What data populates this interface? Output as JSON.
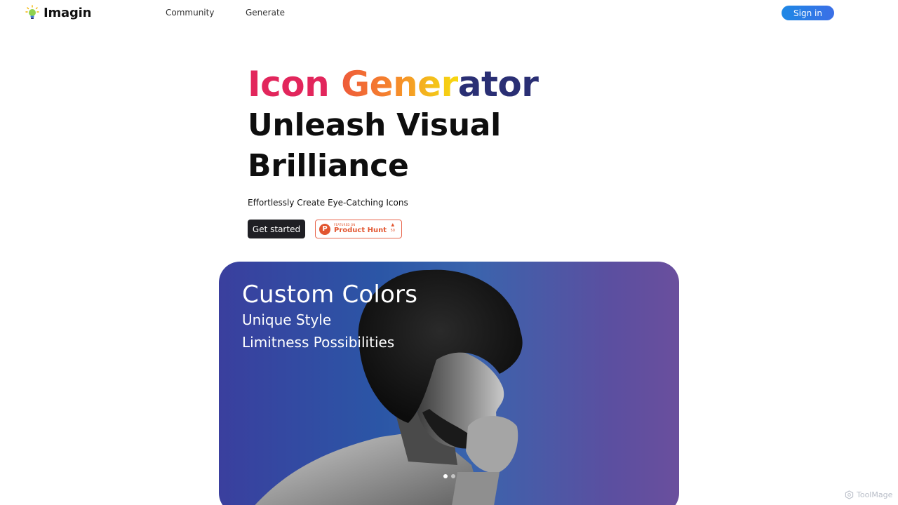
{
  "header": {
    "brand": "Imagin",
    "brand_icon": "lightbulb-icon",
    "nav": [
      "Community",
      "Generate"
    ],
    "signin_label": "Sign in"
  },
  "hero": {
    "title_parts": [
      "Icon",
      "Gener",
      "ator"
    ],
    "headline_line1": "Unleash Visual",
    "headline_line2": "Brilliance",
    "subtitle": "Effortlessly Create Eye-Catching Icons",
    "cta_label": "Get started",
    "product_hunt": {
      "featured": "FEATURED ON",
      "name": "Product Hunt",
      "votes": "50",
      "icon": "product-hunt-icon"
    }
  },
  "showcase": {
    "title": "Custom Colors",
    "line1": "Unique Style",
    "line2": "Limitness Possibilities",
    "slides": 2,
    "active_slide": 0
  },
  "watermark": "ToolMage",
  "colors": {
    "accent_blue": "#1e88e5",
    "icon_pink": "#e2265c",
    "gener_orange": "#f6862c",
    "ator_navy": "#2a2f74",
    "product_hunt": "#e2552f"
  }
}
